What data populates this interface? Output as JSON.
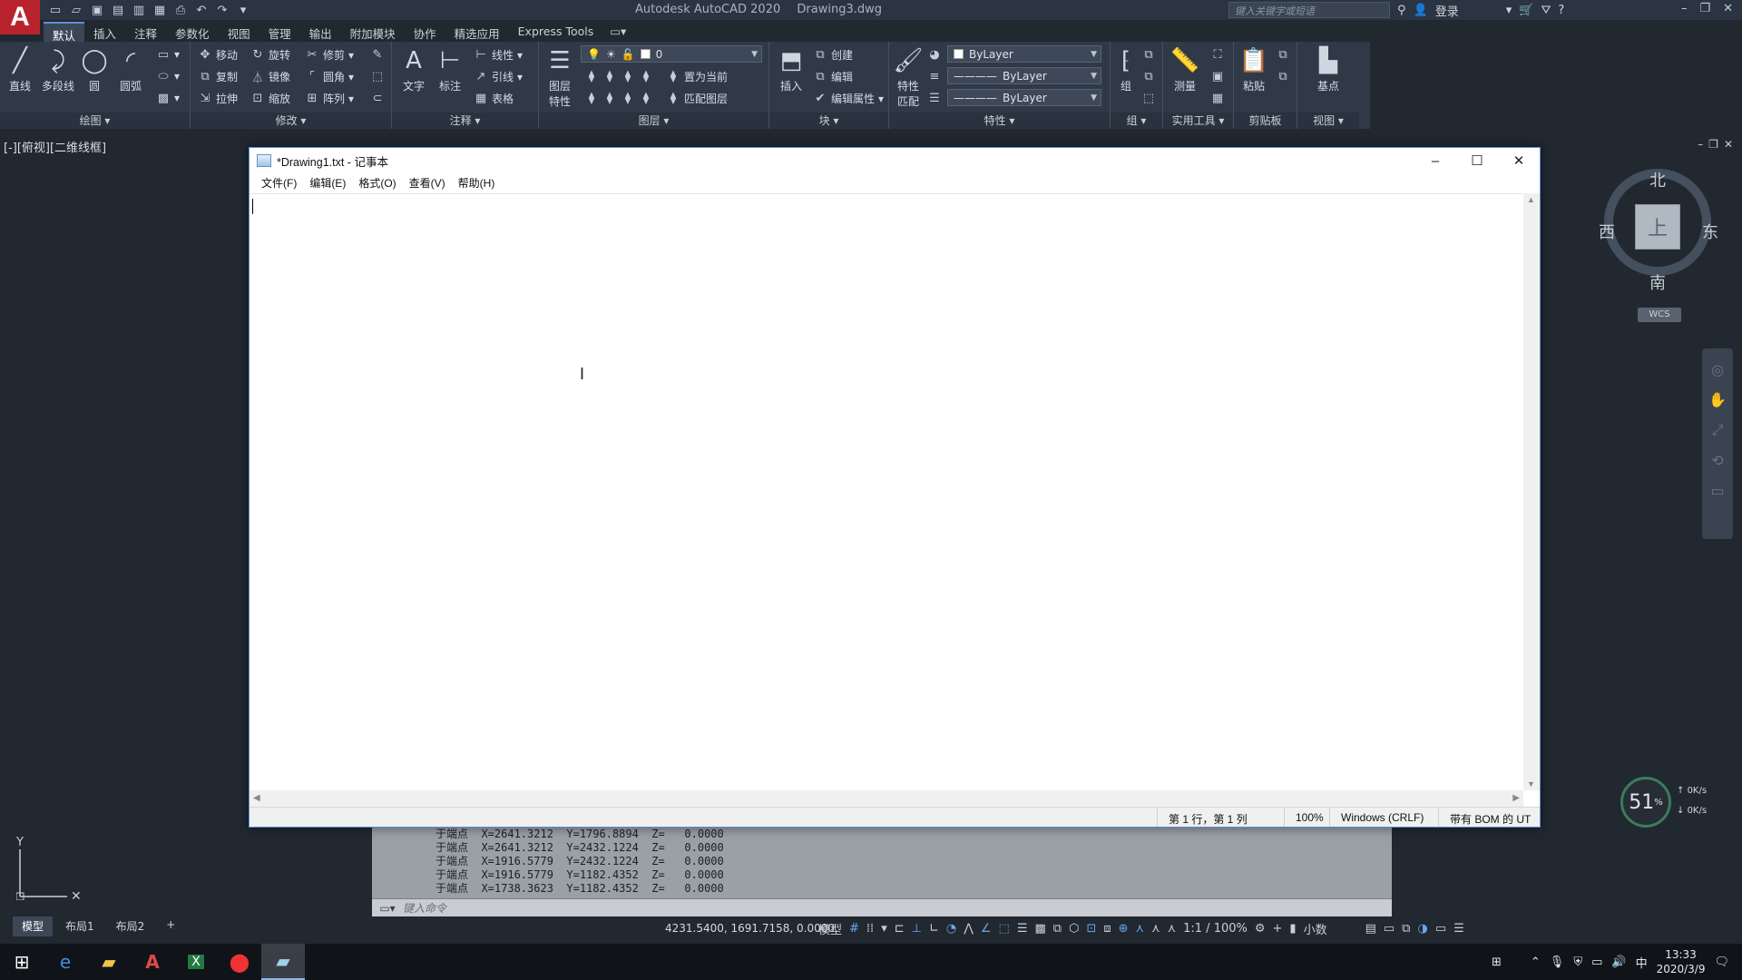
{
  "app": {
    "title": "Autodesk AutoCAD 2020",
    "document": "Drawing3.dwg",
    "search_placeholder": "键入关键字或短语",
    "login": "登录"
  },
  "ribbon_tabs": [
    "默认",
    "插入",
    "注释",
    "参数化",
    "视图",
    "管理",
    "输出",
    "附加模块",
    "协作",
    "精选应用",
    "Express Tools"
  ],
  "ribbon": {
    "draw": {
      "title": "绘图",
      "line": "直线",
      "polyline": "多段线",
      "circle": "圆",
      "arc": "圆弧"
    },
    "modify": {
      "title": "修改",
      "move": "移动",
      "rotate": "旋转",
      "trim": "修剪",
      "copy": "复制",
      "mirror": "镜像",
      "fillet": "圆角",
      "stretch": "拉伸",
      "scale": "缩放",
      "array": "阵列"
    },
    "annotation": {
      "title": "注释",
      "text": "文字",
      "dimension": "标注",
      "linear": "线性",
      "leader": "引线",
      "table": "表格"
    },
    "layers": {
      "title": "图层",
      "layer_props": "图层\n特性",
      "current_layer": "0",
      "make_current": "置为当前",
      "match_layer": "匹配图层"
    },
    "block": {
      "title": "块",
      "insert": "插入",
      "create": "创建",
      "edit": "编辑",
      "edit_attr": "编辑属性"
    },
    "properties": {
      "title": "特性",
      "match": "特性\n匹配",
      "color": "ByLayer",
      "linetype": "ByLayer",
      "lineweight": "ByLayer"
    },
    "groups": {
      "title": "组",
      "group": "组"
    },
    "utilities": {
      "title": "实用工具",
      "measure": "测量"
    },
    "clipboard": {
      "title": "剪贴板",
      "paste": "粘贴"
    },
    "view": {
      "title": "视图",
      "base": "基点"
    }
  },
  "viewport": {
    "label": "[-][俯视][二维线框]",
    "compass": {
      "north": "北",
      "south": "南",
      "east": "东",
      "west": "西",
      "face": "上"
    },
    "wcs": "WCS"
  },
  "command_history": [
    "于端点  X=2641.3212  Y=1796.8894  Z=   0.0000",
    "于端点  X=2641.3212  Y=2432.1224  Z=   0.0000",
    "于端点  X=1916.5779  Y=2432.1224  Z=   0.0000",
    "于端点  X=1916.5779  Y=1182.4352  Z=   0.0000",
    "于端点  X=1738.3623  Y=1182.4352  Z=   0.0000"
  ],
  "command_placeholder": "键入命令",
  "layout_tabs": [
    "模型",
    "布局1",
    "布局2"
  ],
  "status": {
    "coords": "4231.5400, 1691.7158, 0.0000",
    "model": "模型",
    "scale": "1:1 / 100%",
    "units": "小数"
  },
  "perf": {
    "value": "51",
    "unit": "%",
    "up": "0K/s",
    "down": "0K/s"
  },
  "notepad": {
    "title": "*Drawing1.txt - 记事本",
    "menu": [
      "文件(F)",
      "编辑(E)",
      "格式(O)",
      "查看(V)",
      "帮助(H)"
    ],
    "status": {
      "position": "第 1 行，第 1 列",
      "zoom": "100%",
      "eol": "Windows (CRLF)",
      "encoding": "带有 BOM 的 UT"
    }
  },
  "taskbar": {
    "time": "13:33",
    "date": "2020/3/9"
  },
  "colors": {
    "accent": "#5a8fd6",
    "autocad_red": "#b8232e",
    "canvas": "#212830"
  }
}
